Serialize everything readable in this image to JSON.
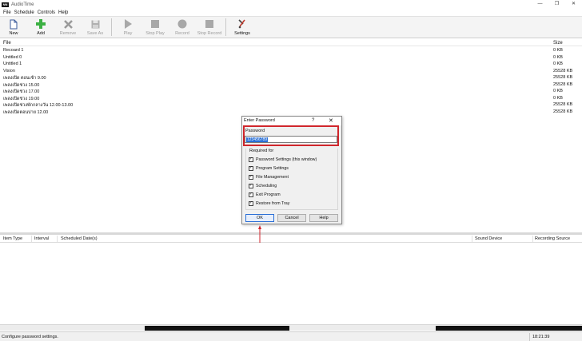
{
  "window": {
    "app_icon_text": "NN",
    "title": "AudioTime",
    "minimize": "—",
    "restore": "❐",
    "close": "✕"
  },
  "menu": {
    "items": [
      {
        "label": "File"
      },
      {
        "label": "Schedule"
      },
      {
        "label": "Controls"
      },
      {
        "label": "Help"
      }
    ]
  },
  "toolbar": {
    "new": "New",
    "add": "Add",
    "remove": "Remove",
    "save_as": "Save As",
    "play": "Play",
    "stop_play": "Stop Play",
    "record": "Record",
    "stop_record": "Stop Record",
    "settings": "Settings",
    "colors": {
      "add": "#3cb043",
      "remove": "#9a9a9a"
    }
  },
  "file_list": {
    "col_file": "File",
    "col_size": "Size",
    "rows": [
      {
        "name": "Recoard 1",
        "size": "0 KB"
      },
      {
        "name": "Untitled 0",
        "size": "0 KB"
      },
      {
        "name": "Untitled 1",
        "size": "0 KB"
      },
      {
        "name": "Vision",
        "size": "25528 KB"
      },
      {
        "name": "เพลงเปิด ตอนเช้า 9.00",
        "size": "25528 KB"
      },
      {
        "name": "เพลงเปิดช่วง 15.00",
        "size": "25528 KB"
      },
      {
        "name": "เพลงเปิดช่วง 17.00",
        "size": "0 KB"
      },
      {
        "name": "เพลงเปิดช่วง 19.00",
        "size": "0 KB"
      },
      {
        "name": "เพลงเปิดช่วงพักกลางวัน 12.00-13.00",
        "size": "25528 KB"
      },
      {
        "name": "เพลงเปิดตอนบ่าย 12.00",
        "size": "25528 KB"
      }
    ]
  },
  "schedule": {
    "col_item_type": "Item Type",
    "col_interval": "Interval",
    "col_dates": "Scheduled Date(s)",
    "col_sound_device": "Sound Device",
    "col_recording_source": "Recording Source"
  },
  "status": {
    "message": "Configure password settings.",
    "time": "18:21:39"
  },
  "dialog": {
    "title": "Enter Password",
    "help_glyph": "?",
    "close_glyph": "✕",
    "password_label": "Password",
    "password_value": "123456789",
    "required_for": "Required for",
    "options": [
      {
        "label": "Password Settings (this window)",
        "checked": true
      },
      {
        "label": "Program Settings",
        "checked": true
      },
      {
        "label": "File Management",
        "checked": true
      },
      {
        "label": "Scheduling",
        "checked": true
      },
      {
        "label": "Exit Program",
        "checked": true
      },
      {
        "label": "Restore from Tray",
        "checked": true
      }
    ],
    "ok": "OK",
    "cancel": "Cancel",
    "help": "Help",
    "highlight_color": "#d0262c"
  }
}
